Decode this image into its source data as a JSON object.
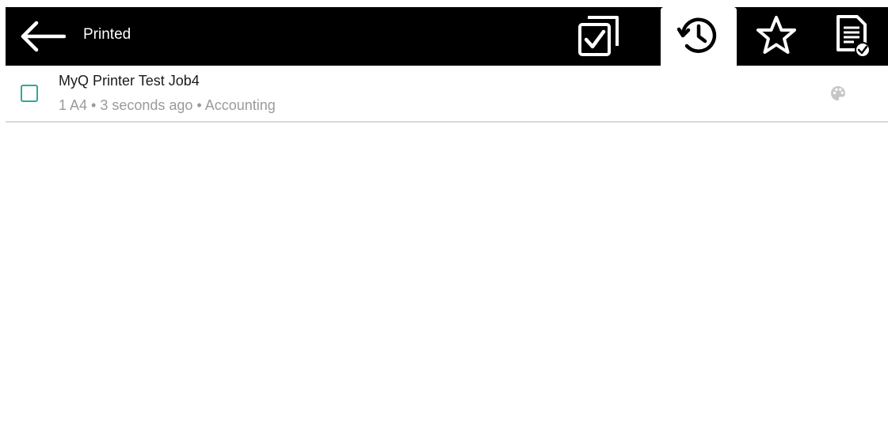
{
  "header": {
    "title": "Printed",
    "tabs": [
      {
        "name": "queue",
        "icon": "checked-documents-icon",
        "active": false
      },
      {
        "name": "history",
        "icon": "history-icon",
        "active": true
      },
      {
        "name": "favorites",
        "icon": "star-icon",
        "active": false
      },
      {
        "name": "printed",
        "icon": "printed-document-icon",
        "active": false
      }
    ]
  },
  "jobs": [
    {
      "name": "MyQ Printer Test Job4",
      "details": "1 A4 • 3 seconds ago • Accounting",
      "color_icon": "palette-icon",
      "checked": false
    }
  ],
  "colors": {
    "header_bg": "#000000",
    "accent": "#2fa89a",
    "secondary_text": "#9a9a9a",
    "divider": "#d9d9d9"
  }
}
